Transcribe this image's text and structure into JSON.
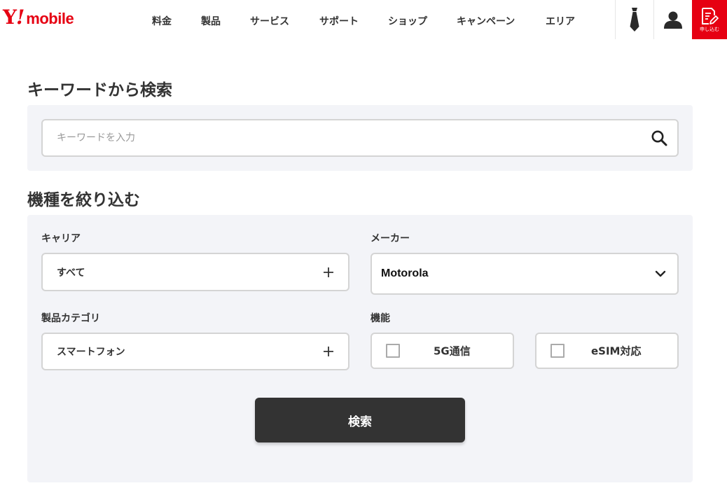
{
  "header": {
    "logo": {
      "y": "Y",
      "mark": "!",
      "mobile": "mobile"
    },
    "nav": [
      {
        "label": "料金"
      },
      {
        "label": "製品"
      },
      {
        "label": "サービス"
      },
      {
        "label": "サポート"
      },
      {
        "label": "ショップ"
      },
      {
        "label": "キャンペーン"
      },
      {
        "label": "エリア"
      }
    ],
    "icons": {
      "business": "tie-icon",
      "account": "user-icon",
      "apply": "document-edit-icon"
    },
    "apply_label": "申し込む"
  },
  "keyword_section": {
    "title": "キーワードから検索",
    "placeholder": "キーワードを入力",
    "value": ""
  },
  "filter_section": {
    "title": "機種を絞り込む",
    "carrier": {
      "label": "キャリア",
      "value": "すべて"
    },
    "maker": {
      "label": "メーカー",
      "value": "Motorola"
    },
    "category": {
      "label": "製品カテゴリ",
      "value": "スマートフォン"
    },
    "features": {
      "label": "機能",
      "options": [
        {
          "label": "5G通信",
          "checked": false
        },
        {
          "label": "eSIM対応",
          "checked": false
        }
      ]
    },
    "submit_label": "検索"
  },
  "colors": {
    "brand": "#e60012",
    "panel": "#f3f4f8",
    "button": "#333333"
  }
}
